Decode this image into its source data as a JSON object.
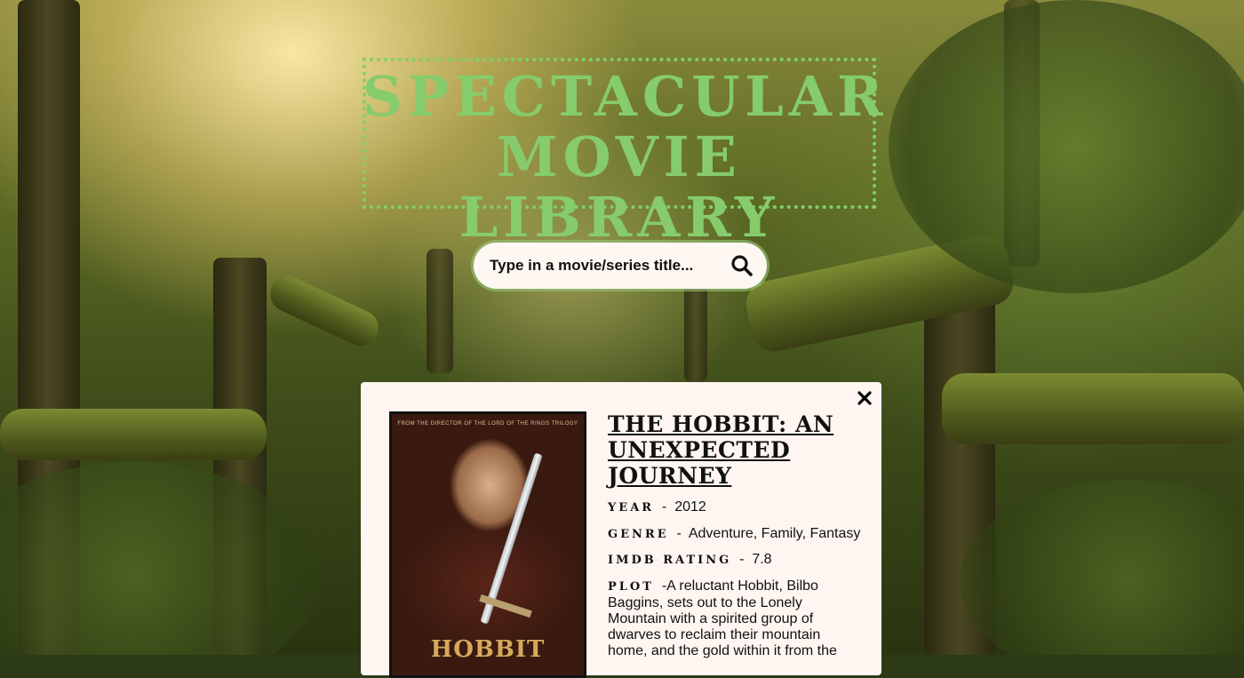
{
  "header": {
    "title": "SPECTACULAR MOVIE LIBRARY"
  },
  "search": {
    "placeholder": "Type in a movie/series title...",
    "icon": "search-icon"
  },
  "modal": {
    "close_icon": "close-icon",
    "poster": {
      "tagline": "FROM THE DIRECTOR OF THE LORD OF THE RINGS TRILOGY",
      "logo_text": "HOBBIT"
    },
    "movie_title": "THE HOBBIT: AN UNEXPECTED JOURNEY",
    "year_label": "YEAR",
    "year_value": "2012",
    "genre_label": "GENRE",
    "genre_value": "Adventure, Family, Fantasy",
    "rating_label": "IMDB RATING",
    "rating_value": "7.8",
    "plot_label": "PLOT",
    "plot_value": "A reluctant Hobbit, Bilbo Baggins, sets out to the Lonely Mountain with a spirited group of dwarves to reclaim their mountain home, and the gold within it from the"
  },
  "colors": {
    "title_green": "#86cc6c",
    "modal_bg": "#fff6f1",
    "search_bg": "#fff7f1"
  }
}
